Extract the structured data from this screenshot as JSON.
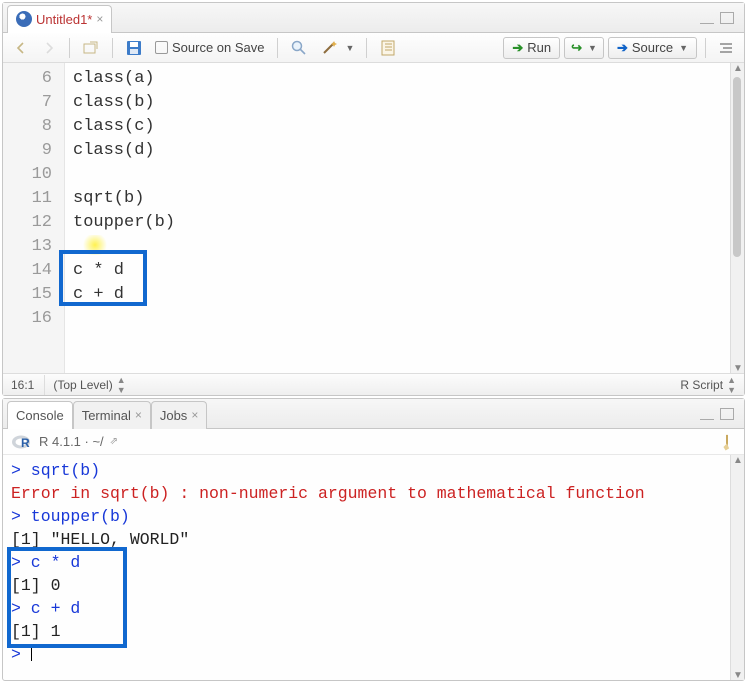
{
  "editor": {
    "tab_title": "Untitled1*",
    "toolbar": {
      "source_on_save": "Source on Save",
      "run": "Run",
      "source": "Source"
    },
    "gutter": [
      "6",
      "7",
      "8",
      "9",
      "10",
      "11",
      "12",
      "13",
      "14",
      "15",
      "16"
    ],
    "lines": [
      "class(a)",
      "class(b)",
      "class(c)",
      "class(d)",
      "",
      "sqrt(b)",
      "toupper(b)",
      "",
      "c * d",
      "c + d",
      ""
    ],
    "status": {
      "pos": "16:1",
      "scope": "(Top Level)",
      "lang": "R Script"
    }
  },
  "console": {
    "tabs": {
      "console": "Console",
      "terminal": "Terminal",
      "jobs": "Jobs"
    },
    "info": "R 4.1.1 · ~/",
    "lines": [
      {
        "cls": "cblue",
        "text": "> sqrt(b)"
      },
      {
        "cls": "cred",
        "text": "Error in sqrt(b) : non-numeric argument to mathematical function"
      },
      {
        "cls": "cblue",
        "text": "> toupper(b)"
      },
      {
        "cls": "cblack",
        "text": "[1] \"HELLO, WORLD\""
      },
      {
        "cls": "cblue",
        "text": "> c * d"
      },
      {
        "cls": "cblack",
        "text": "[1] 0"
      },
      {
        "cls": "cblue",
        "text": "> c + d"
      },
      {
        "cls": "cblack",
        "text": "[1] 1"
      },
      {
        "cls": "cblue",
        "text": "> "
      }
    ]
  }
}
